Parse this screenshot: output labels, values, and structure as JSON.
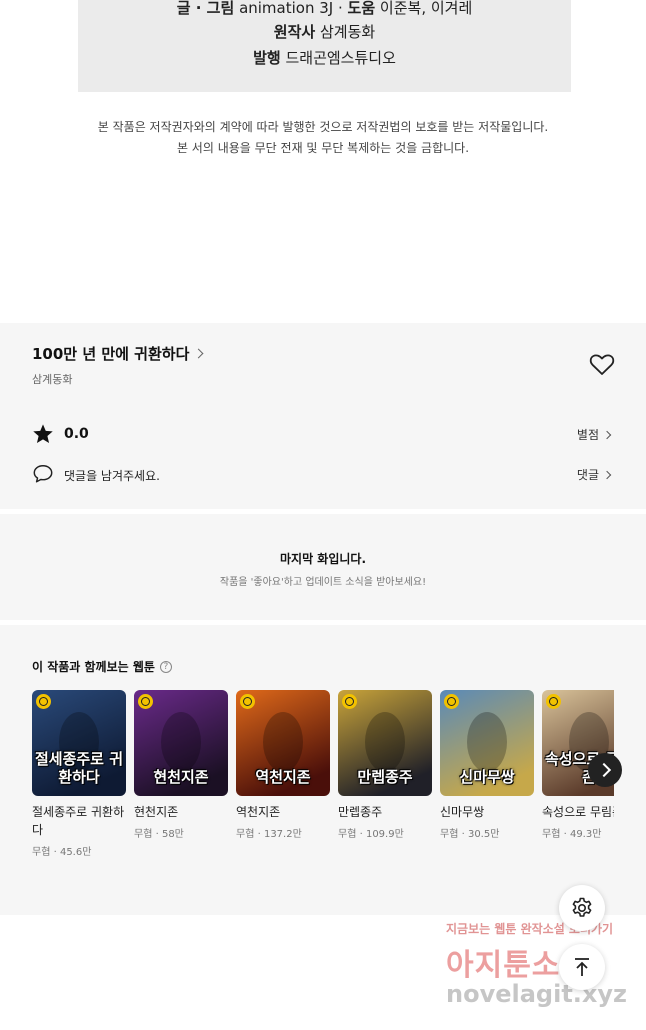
{
  "credits": {
    "line1": [
      {
        "label": "글 · 그림",
        "value": "animation 3J"
      },
      {
        "label": "도움",
        "value": "이준복, 이겨레"
      }
    ],
    "line2": {
      "label": "원작사",
      "value": "삼계동화"
    },
    "line3": {
      "label": "발행",
      "value": "드래곤엠스튜디오"
    }
  },
  "copyright": {
    "line1": "본 작품은 저작권자와의 계약에 따라 발행한 것으로 저작권법의 보호를 받는 저작물입니다.",
    "line2": "본 서의 내용을 무단 전재 및 무단 복제하는 것을 금합니다."
  },
  "info": {
    "title": "100만 년 만에 귀환하다",
    "author": "삼계동화",
    "rating": "0.0",
    "rating_link": "별점",
    "comment_placeholder": "댓글을 남겨주세요.",
    "comment_link": "댓글"
  },
  "last_episode": {
    "heading": "마지막 화입니다.",
    "sub": "작품을 '좋아요'하고 업데이트 소식을 받아보세요!"
  },
  "recommendations": {
    "title": "이 작품과 함께보는 웹툰",
    "help": "?",
    "items": [
      {
        "name": "절세종주로 귀환하다",
        "thumb_text": "절세종주로 귀환하다",
        "genre": "무협",
        "views": "45.6만",
        "colors": [
          "#2a4a7a",
          "#0e1a33"
        ]
      },
      {
        "name": "현천지존",
        "thumb_text": "현천지존",
        "genre": "무협",
        "views": "58만",
        "colors": [
          "#6a2a8a",
          "#1b1024"
        ]
      },
      {
        "name": "역천지존",
        "thumb_text": "역천지존",
        "genre": "무협",
        "views": "137.2만",
        "colors": [
          "#e06a1a",
          "#4a0f0a"
        ]
      },
      {
        "name": "만렙종주",
        "thumb_text": "만렙종주",
        "genre": "무협",
        "views": "109.9만",
        "colors": [
          "#c9a43a",
          "#202028"
        ]
      },
      {
        "name": "신마무쌍",
        "thumb_text": "신마무쌍",
        "genre": "무협",
        "views": "30.5만",
        "colors": [
          "#5a8ab8",
          "#c6a84a"
        ]
      },
      {
        "name": "속성으로 무림존",
        "thumb_text": "속성으로 무림존",
        "genre": "무협",
        "views": "49.3만",
        "colors": [
          "#d9c39a",
          "#5a3a2a"
        ]
      }
    ],
    "meta_sep": " · "
  },
  "watermark": {
    "line1": "지금보는 웹툰 완작소설 보러가기",
    "line2": "아지툰소설",
    "line3": "novelagit.xyz"
  },
  "icons": {
    "heart": "heart-icon",
    "star": "star-icon",
    "comment": "speech-bubble-icon",
    "settings": "gear-icon",
    "top": "arrow-up-icon",
    "next": "chevron-right-icon",
    "badge": "clock-icon"
  }
}
